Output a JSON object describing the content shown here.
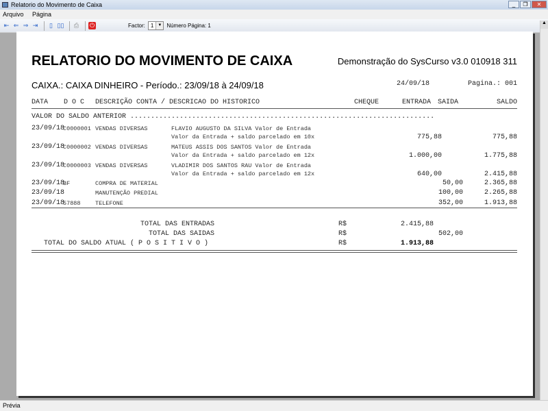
{
  "window": {
    "title": "Relatorio do Movimento de Caixa",
    "controls": [
      "_",
      "❐",
      "✕"
    ]
  },
  "menu": [
    "Arquivo",
    "Página"
  ],
  "toolbar": {
    "factor_label": "Factor:",
    "factor_value": "1",
    "page_label": "Número Página: 1"
  },
  "report": {
    "title": "RELATORIO DO MOVIMENTO DE CAIXA",
    "subtitle": "Demonstração do SysCurso v3.0 010918 311",
    "caixa": "CAIXA.: CAIXA DINHEIRO -  Período.: 23/09/18 à 24/09/18",
    "date": "24/09/18",
    "page": "Pagina.: 001",
    "columns": {
      "data": "DATA",
      "doc": "D O C",
      "desc": "DESCRIÇÃO CONTA / DESCRICAO DO HISTORICO",
      "cheque": "CHEQUE",
      "entrada": "ENTRADA",
      "saida": "SAIDA",
      "saldo": "SALDO"
    },
    "saldo_anterior": "VALOR DO SALDO ANTERIOR ..........................................................................",
    "rows": [
      {
        "date": "23/09/18",
        "doc": "C0000001",
        "conta": "VENDAS DIVERSAS",
        "hist1": "FLAVIO AUGUSTO DA SILVA Valor de Entrada",
        "hist2": "Valor da Entrada + saldo parcelado em 10x",
        "entrada": "775,88",
        "saida": "",
        "saldo": "775,88"
      },
      {
        "date": "23/09/18",
        "doc": "C0000002",
        "conta": "VENDAS DIVERSAS",
        "hist1": "MATEUS ASSIS DOS SANTOS Valor de Entrada",
        "hist2": "Valor da Entrada + saldo parcelado em 12x",
        "entrada": "1.000,00",
        "saida": "",
        "saldo": "1.775,88"
      },
      {
        "date": "23/09/18",
        "doc": "C0000003",
        "conta": "VENDAS DIVERSAS",
        "hist1": "VLADIMIR DOS SANTOS RAU Valor de Entrada",
        "hist2": "Valor da Entrada + saldo parcelado em 12x",
        "entrada": "640,00",
        "saida": "",
        "saldo": "2.415,88"
      },
      {
        "date": "23/09/18",
        "doc": "BF",
        "conta": "COMPRA DE MATERIAL",
        "hist1": "",
        "hist2": "",
        "entrada": "",
        "saida": "50,00",
        "saldo": "2.365,88"
      },
      {
        "date": "23/09/18",
        "doc": "",
        "conta": "MANUTENÇÃO PREDIAL",
        "hist1": "",
        "hist2": "",
        "entrada": "",
        "saida": "100,00",
        "saldo": "2.265,88"
      },
      {
        "date": "23/09/18",
        "doc": "57888",
        "conta": "TELEFONE",
        "hist1": "",
        "hist2": "",
        "entrada": "",
        "saida": "352,00",
        "saldo": "1.913,88"
      }
    ],
    "totals": {
      "entradas_label": "TOTAL DAS ENTRADAS",
      "entradas_cur": "R$",
      "entradas": "2.415,88",
      "saidas_label": "TOTAL DAS SAIDAS",
      "saidas_cur": "R$",
      "saidas": "502,00",
      "saldo_label": "TOTAL DO SALDO ATUAL ( P O S I T I V O )",
      "saldo_cur": "R$",
      "saldo": "1.913,88"
    }
  },
  "status": "Prévia"
}
